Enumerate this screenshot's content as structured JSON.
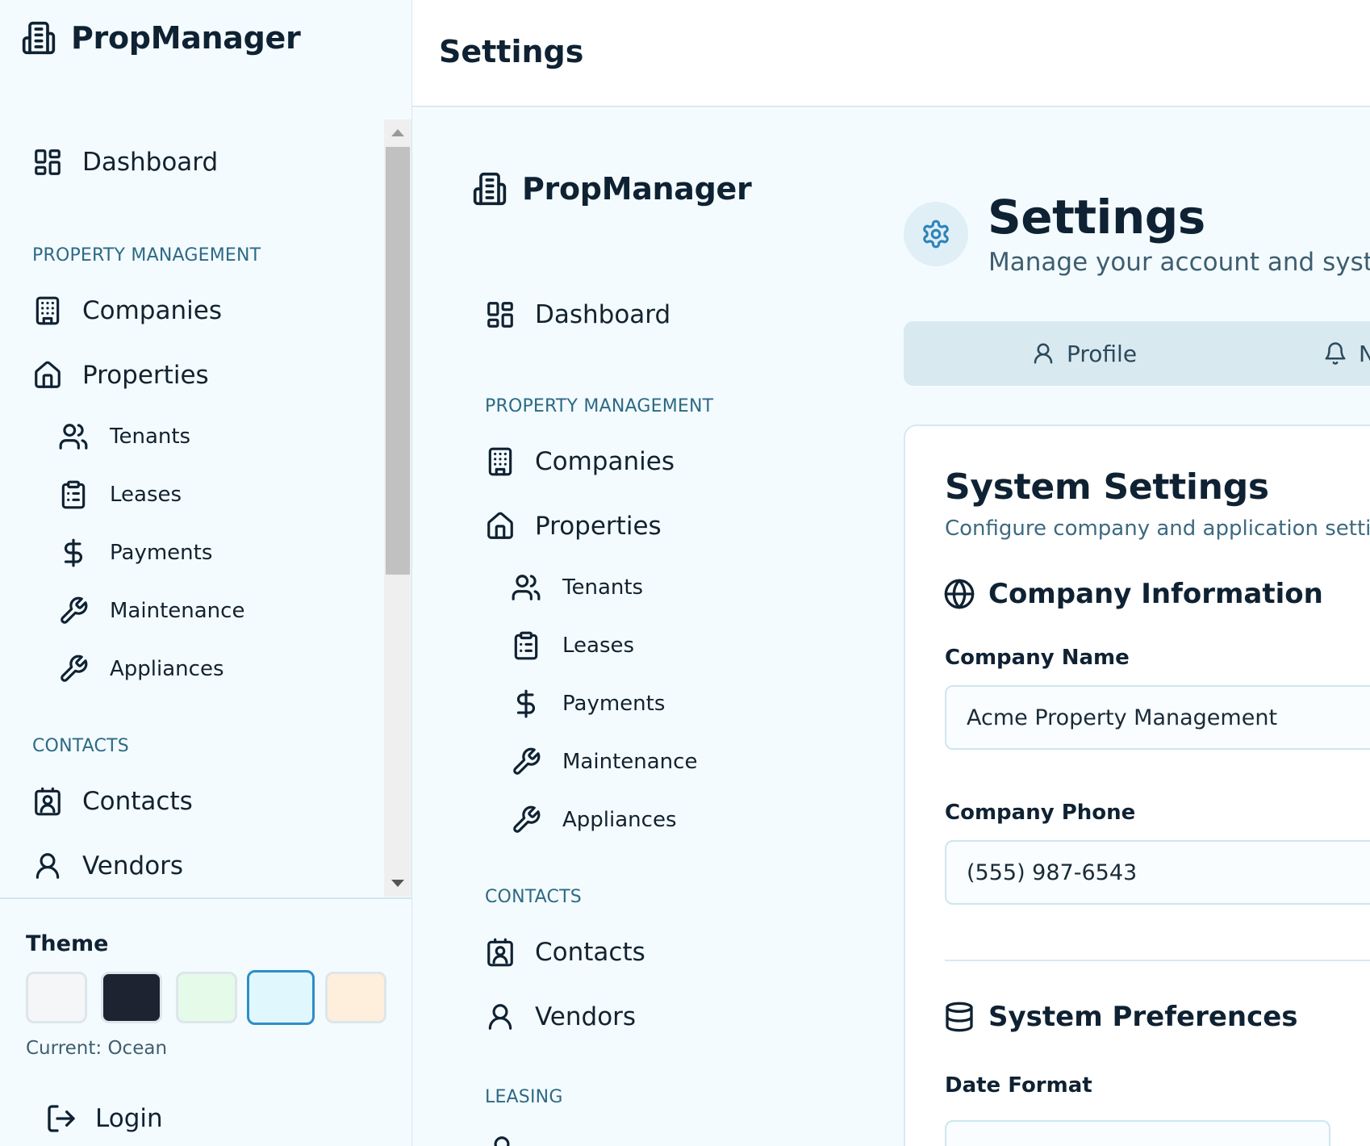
{
  "app": {
    "name": "PropManager"
  },
  "sidebar": {
    "dashboard": "Dashboard",
    "section_property": "PROPERTY MANAGEMENT",
    "companies": "Companies",
    "properties": "Properties",
    "tenants": "Tenants",
    "leases": "Leases",
    "payments": "Payments",
    "maintenance": "Maintenance",
    "appliances": "Appliances",
    "section_contacts": "CONTACTS",
    "contacts": "Contacts",
    "vendors": "Vendors",
    "section_leasing": "LEASING"
  },
  "theme": {
    "title": "Theme",
    "current": "Current: Ocean",
    "swatches": [
      {
        "name": "light",
        "color": "#f5f6f7"
      },
      {
        "name": "dark",
        "color": "#1d2331"
      },
      {
        "name": "mint",
        "color": "#e6faea"
      },
      {
        "name": "ocean",
        "color": "#e0f8fd"
      },
      {
        "name": "sand",
        "color": "#fdefdc"
      }
    ],
    "active": "ocean"
  },
  "login": {
    "label": "Login"
  },
  "topbar": {
    "title": "Settings"
  },
  "page": {
    "title": "Settings",
    "subtitle": "Manage your account and system"
  },
  "tabs": [
    {
      "label": "Profile"
    },
    {
      "label": "N"
    }
  ],
  "system_settings": {
    "title": "System Settings",
    "subtitle": "Configure company and application setting",
    "company_info": {
      "heading": "Company Information",
      "name_label": "Company Name",
      "name_value": "Acme Property Management",
      "phone_label": "Company Phone",
      "phone_value": "(555) 987-6543"
    },
    "preferences": {
      "heading": "System Preferences",
      "date_format_label": "Date Format"
    }
  }
}
